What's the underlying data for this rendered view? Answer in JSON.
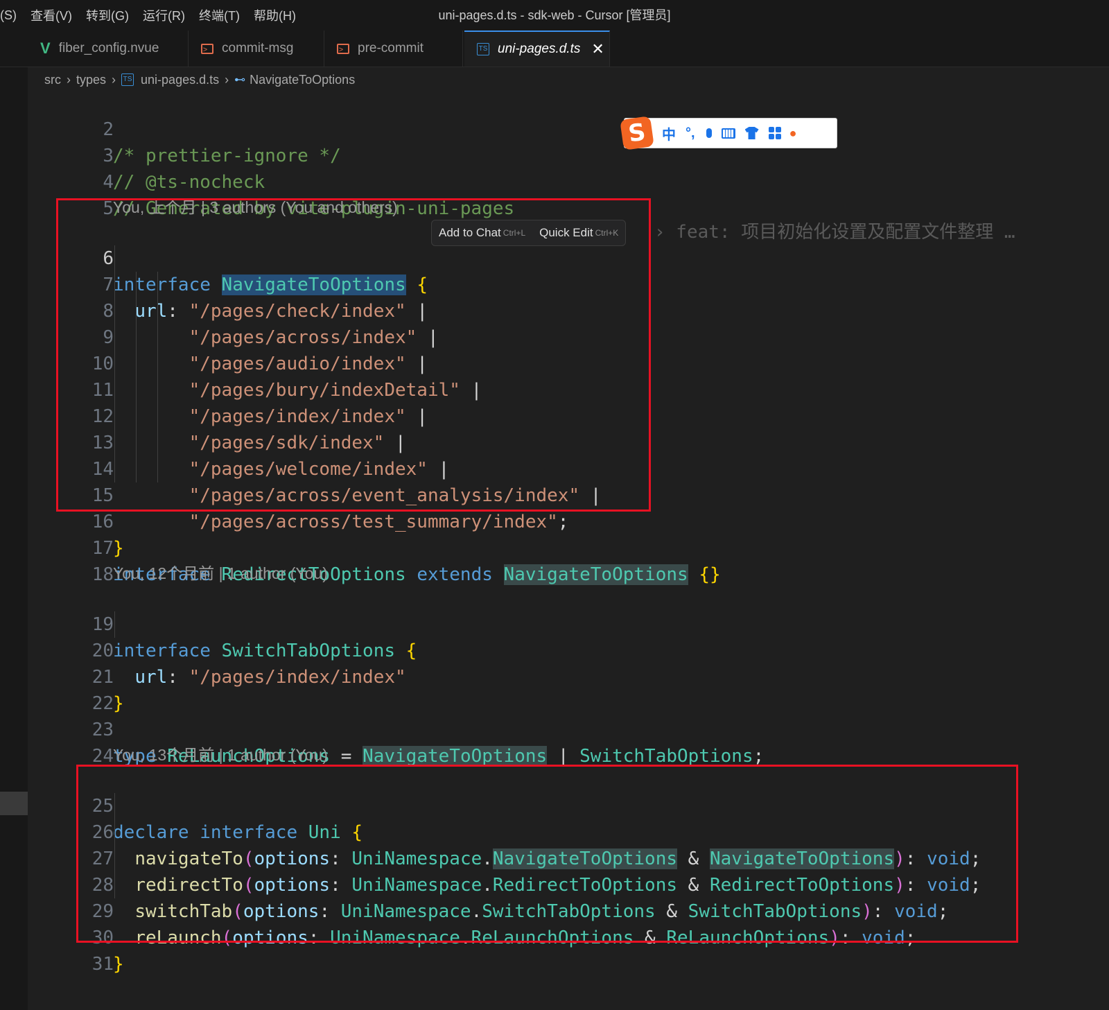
{
  "menu": [
    "(S)",
    "查看(V)",
    "转到(G)",
    "运行(R)",
    "终端(T)",
    "帮助(H)"
  ],
  "window_title": "uni-pages.d.ts - sdk-web - Cursor [管理员]",
  "tabs": [
    {
      "label": "fiber_config.nvue",
      "icon": "vue-icon"
    },
    {
      "label": "commit-msg",
      "icon": "terminal-file-icon"
    },
    {
      "label": "pre-commit",
      "icon": "terminal-file-icon"
    },
    {
      "label": "uni-pages.d.ts",
      "icon": "typescript-file-icon",
      "active": true
    }
  ],
  "breadcrumb": {
    "parts": [
      "src",
      "types",
      "uni-pages.d.ts",
      "NavigateToOptions"
    ]
  },
  "icons": {
    "ts_badge": "TS",
    "close": "✕",
    "symbol_icon": "⊷"
  },
  "popup": {
    "add_to_chat": "Add to Chat",
    "add_to_chat_key": "Ctrl+L",
    "quick_edit": "Quick Edit",
    "quick_edit_key": "Ctrl+K"
  },
  "blame_inline": "› feat: 项目初始化设置及配置文件整理 …",
  "codelens": [
    "You, 上个月 | 3 authors (You and others)",
    "You, 12个月前 | 1 author (You)",
    "You, 13个月前 | 1 author (You)"
  ],
  "ime": {
    "brand": "S",
    "mode": "中",
    "punct": "°,"
  },
  "line_numbers": {
    "l2": "2",
    "l3": "3",
    "l4": "4",
    "l5": "5",
    "l6": "6",
    "l7": "7",
    "l8": "8",
    "l9": "9",
    "l10": "10",
    "l11": "11",
    "l12": "12",
    "l13": "13",
    "l14": "14",
    "l15": "15",
    "l16": "16",
    "l17": "17",
    "l18": "18",
    "l19": "19",
    "l20": "20",
    "l21": "21",
    "l22": "22",
    "l23": "23",
    "l24": "24",
    "l25": "25",
    "l26": "26",
    "l27": "27",
    "l28": "28",
    "l29": "29",
    "l30": "30",
    "l31": "31"
  },
  "code": {
    "l2": "/* prettier-ignore */",
    "l3": "// @ts-nocheck",
    "l4": "// Generated by vite-plugin-uni-pages",
    "kw_interface": "interface",
    "kw_extends": "extends",
    "kw_type": "type",
    "kw_declare": "declare",
    "kw_void": "void",
    "NavigateToOptions": "NavigateToOptions",
    "RedirectToOptions": "RedirectToOptions",
    "SwitchTabOptions": "SwitchTabOptions",
    "ReLaunchOptions": "ReLaunchOptions",
    "UniNamespace": "UniNamespace",
    "Uni": "Uni",
    "url": "url",
    "options": "options",
    "navigateTo": "navigateTo",
    "redirectTo": "redirectTo",
    "switchTab": "switchTab",
    "reLaunch": "reLaunch",
    "p7": "\"/pages/check/index\"",
    "p8": "\"/pages/across/index\"",
    "p9": "\"/pages/audio/index\"",
    "p10": "\"/pages/bury/indexDetail\"",
    "p11": "\"/pages/index/index\"",
    "p12": "\"/pages/sdk/index\"",
    "p13": "\"/pages/welcome/index\"",
    "p14": "\"/pages/across/event_analysis/index\"",
    "p15": "\"/pages/across/test_summary/index\"",
    "p20": "\"/pages/index/index\""
  }
}
